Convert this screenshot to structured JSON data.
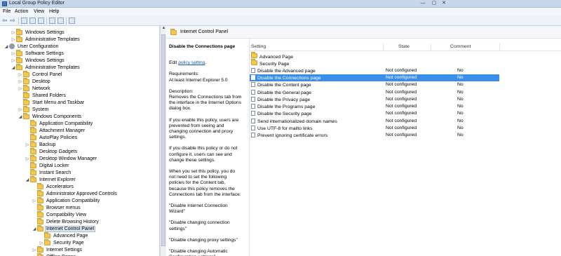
{
  "window": {
    "title": "Local Group Policy Editor",
    "min": "—",
    "max": "▢",
    "close": "✕"
  },
  "menu": [
    "File",
    "Action",
    "View",
    "Help"
  ],
  "tree": [
    {
      "label": "Windows Settings",
      "indent": 1,
      "expander": "▷",
      "icon": "folder"
    },
    {
      "label": "Administrative Templates",
      "indent": 1,
      "expander": "▷",
      "icon": "folder"
    },
    {
      "label": "User Configuration",
      "indent": 0,
      "expander": "◢",
      "icon": "gear"
    },
    {
      "label": "Software Settings",
      "indent": 1,
      "expander": "▷",
      "icon": "folder"
    },
    {
      "label": "Windows Settings",
      "indent": 1,
      "expander": "▷",
      "icon": "folder"
    },
    {
      "label": "Administrative Templates",
      "indent": 1,
      "expander": "◢",
      "icon": "folder"
    },
    {
      "label": "Control Panel",
      "indent": 2,
      "expander": "▷",
      "icon": "folder"
    },
    {
      "label": "Desktop",
      "indent": 2,
      "expander": "▷",
      "icon": "folder"
    },
    {
      "label": "Network",
      "indent": 2,
      "expander": "▷",
      "icon": "folder"
    },
    {
      "label": "Shared Folders",
      "indent": 2,
      "expander": "",
      "icon": "folder"
    },
    {
      "label": "Start Menu and Taskbar",
      "indent": 2,
      "expander": "",
      "icon": "folder"
    },
    {
      "label": "System",
      "indent": 2,
      "expander": "▷",
      "icon": "folder"
    },
    {
      "label": "Windows Components",
      "indent": 2,
      "expander": "◢",
      "icon": "folder"
    },
    {
      "label": "Application Compatibility",
      "indent": 3,
      "expander": "",
      "icon": "folder"
    },
    {
      "label": "Attachment Manager",
      "indent": 3,
      "expander": "",
      "icon": "folder"
    },
    {
      "label": "AutoPlay Policies",
      "indent": 3,
      "expander": "",
      "icon": "folder"
    },
    {
      "label": "Backup",
      "indent": 3,
      "expander": "▷",
      "icon": "folder"
    },
    {
      "label": "Desktop Gadgets",
      "indent": 3,
      "expander": "",
      "icon": "folder"
    },
    {
      "label": "Desktop Window Manager",
      "indent": 3,
      "expander": "▷",
      "icon": "folder"
    },
    {
      "label": "Digital Locker",
      "indent": 3,
      "expander": "",
      "icon": "folder"
    },
    {
      "label": "Instant Search",
      "indent": 3,
      "expander": "",
      "icon": "folder"
    },
    {
      "label": "Internet Explorer",
      "indent": 3,
      "expander": "◢",
      "icon": "folder"
    },
    {
      "label": "Accelerators",
      "indent": 4,
      "expander": "",
      "icon": "folder"
    },
    {
      "label": "Administrator Approved Controls",
      "indent": 4,
      "expander": "",
      "icon": "folder"
    },
    {
      "label": "Application Compatibility",
      "indent": 4,
      "expander": "▷",
      "icon": "folder"
    },
    {
      "label": "Browser menus",
      "indent": 4,
      "expander": "",
      "icon": "folder"
    },
    {
      "label": "Compatibility View",
      "indent": 4,
      "expander": "",
      "icon": "folder"
    },
    {
      "label": "Delete Browsing History",
      "indent": 4,
      "expander": "",
      "icon": "folder"
    },
    {
      "label": "Internet Control Panel",
      "indent": 4,
      "expander": "◢",
      "icon": "folder",
      "selected": true
    },
    {
      "label": "Advanced Page",
      "indent": 5,
      "expander": "",
      "icon": "folder"
    },
    {
      "label": "Security Page",
      "indent": 5,
      "expander": "▷",
      "icon": "folder"
    },
    {
      "label": "Internet Settings",
      "indent": 4,
      "expander": "▷",
      "icon": "folder"
    },
    {
      "label": "Offline Pages",
      "indent": 4,
      "expander": "",
      "icon": "folder"
    }
  ],
  "right_header": {
    "title": "Internet Control Panel"
  },
  "description": {
    "title": "Disable the Connections page",
    "edit_prefix": "Edit ",
    "edit_link": "policy setting",
    "edit_suffix": ".",
    "requirements_label": "Requirements:",
    "requirements_value": "At least Internet Explorer 5.0",
    "description_label": "Description:",
    "paragraphs": [
      "Removes the Connections tab from the interface in the Internet Options dialog box.",
      "If you enable this policy, users are prevented from seeing and changing connection and proxy settings.",
      "If you disable this policy or do not configure it, users can see and change these settings.",
      "When you set this policy, you do not need to set the following policies for the Content tab, because this policy removes the Connections tab from the interface:",
      "\"Disable Internet Connection Wizard\"",
      "\"Disable changing connection settings\"",
      "\"Disable changing proxy settings\"",
      "\"Disable changing Automatic Configuration settings\""
    ]
  },
  "list": {
    "columns": {
      "setting": "Setting",
      "state": "State",
      "comment": "Comment"
    },
    "folders": [
      "Advanced Page",
      "Security Page"
    ],
    "rows": [
      {
        "setting": "Disable the Advanced page",
        "state": "Not configured",
        "comment": "No"
      },
      {
        "setting": "Disable the Connections page",
        "state": "Not configured",
        "comment": "No",
        "selected": true
      },
      {
        "setting": "Disable the Content page",
        "state": "Not configured",
        "comment": "No"
      },
      {
        "setting": "Disable the General page",
        "state": "Not configured",
        "comment": "No"
      },
      {
        "setting": "Disable the Privacy page",
        "state": "Not configured",
        "comment": "No"
      },
      {
        "setting": "Disable the Programs page",
        "state": "Not configured",
        "comment": "No"
      },
      {
        "setting": "Disable the Security page",
        "state": "Not configured",
        "comment": "No"
      },
      {
        "setting": "Send internationalized domain names",
        "state": "Not configured",
        "comment": "No"
      },
      {
        "setting": "Use UTF-8 for mailto links",
        "state": "Not configured",
        "comment": "No"
      },
      {
        "setting": "Prevent ignoring certificate errors",
        "state": "Not configured",
        "comment": "No"
      }
    ]
  }
}
